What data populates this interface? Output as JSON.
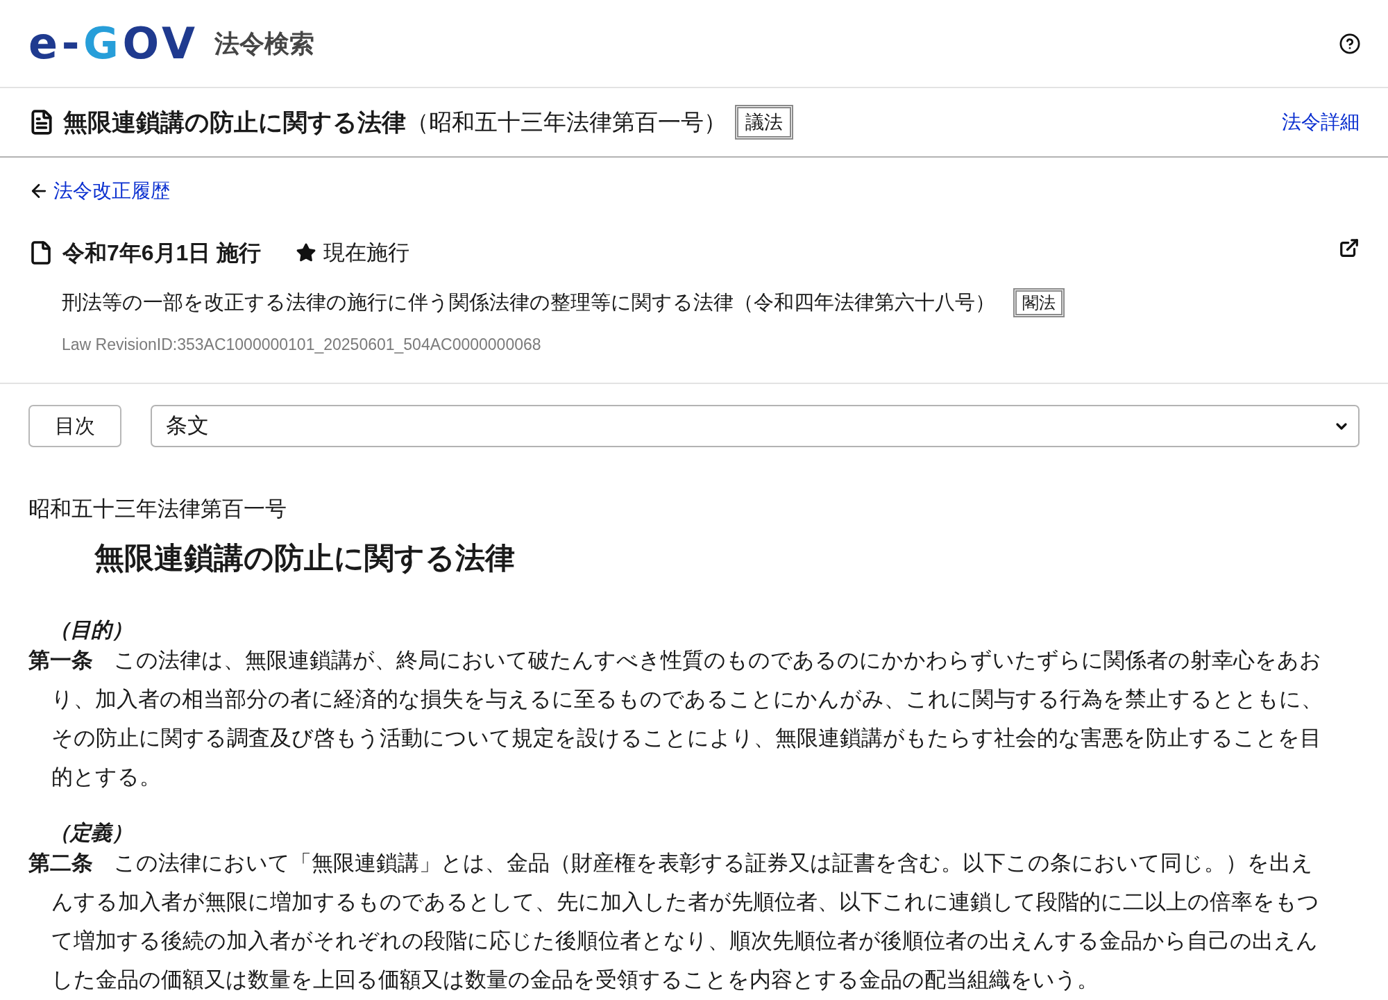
{
  "header": {
    "logo": {
      "segments": [
        {
          "text": "e-",
          "color": "#1f3a8f"
        },
        {
          "text": "G",
          "color": "#279ed9"
        },
        {
          "text": "OV",
          "color": "#1f3a8f"
        }
      ]
    },
    "app_name": "法令検索"
  },
  "law_bar": {
    "title": "無限連鎖講の防止に関する法律",
    "number": "（昭和五十三年法律第百一号）",
    "badge": "議法",
    "detail_link": "法令詳細"
  },
  "back_link": "法令改正履歴",
  "revision": {
    "effective_date": "令和7年6月1日 施行",
    "status": "現在施行",
    "amending_law": "刑法等の一部を改正する法律の施行に伴う関係法律の整理等に関する法律（令和四年法律第六十八号）",
    "amending_badge": "閣法",
    "revision_id": "Law RevisionID:353AC1000000101_20250601_504AC0000000068"
  },
  "toolbar": {
    "toc_button": "目次",
    "section_select": {
      "value": "条文"
    }
  },
  "document": {
    "law_number": "昭和五十三年法律第百一号",
    "title": "無限連鎖講の防止に関する法律",
    "articles": [
      {
        "caption": "（目的）",
        "heading": "第一条",
        "text": "この法律は、無限連鎖講が、終局において破たんすべき性質のものであるのにかかわらずいたずらに関係者の射幸心をあおり、加入者の相当部分の者に経済的な損失を与えるに至るものであることにかんがみ、これに関与する行為を禁止するとともに、その防止に関する調査及び啓もう活動について規定を設けることにより、無限連鎖講がもたらす社会的な害悪を防止することを目的とする。"
      },
      {
        "caption": "（定義）",
        "heading": "第二条",
        "text": "この法律において「無限連鎖講」とは、金品（財産権を表彰する証券又は証書を含む。以下この条において同じ。）を出えんする加入者が無限に増加するものであるとして、先に加入した者が先順位者、以下これに連鎖して段階的に二以上の倍率をもつて増加する後続の加入者がそれぞれの段階に応じた後順位者となり、順次先順位者が後順位者の出えんする金品から自己の出えんした金品の価額又は数量を上回る価額又は数量の金品を受領することを内容とする金品の配当組織をいう。"
      }
    ]
  }
}
